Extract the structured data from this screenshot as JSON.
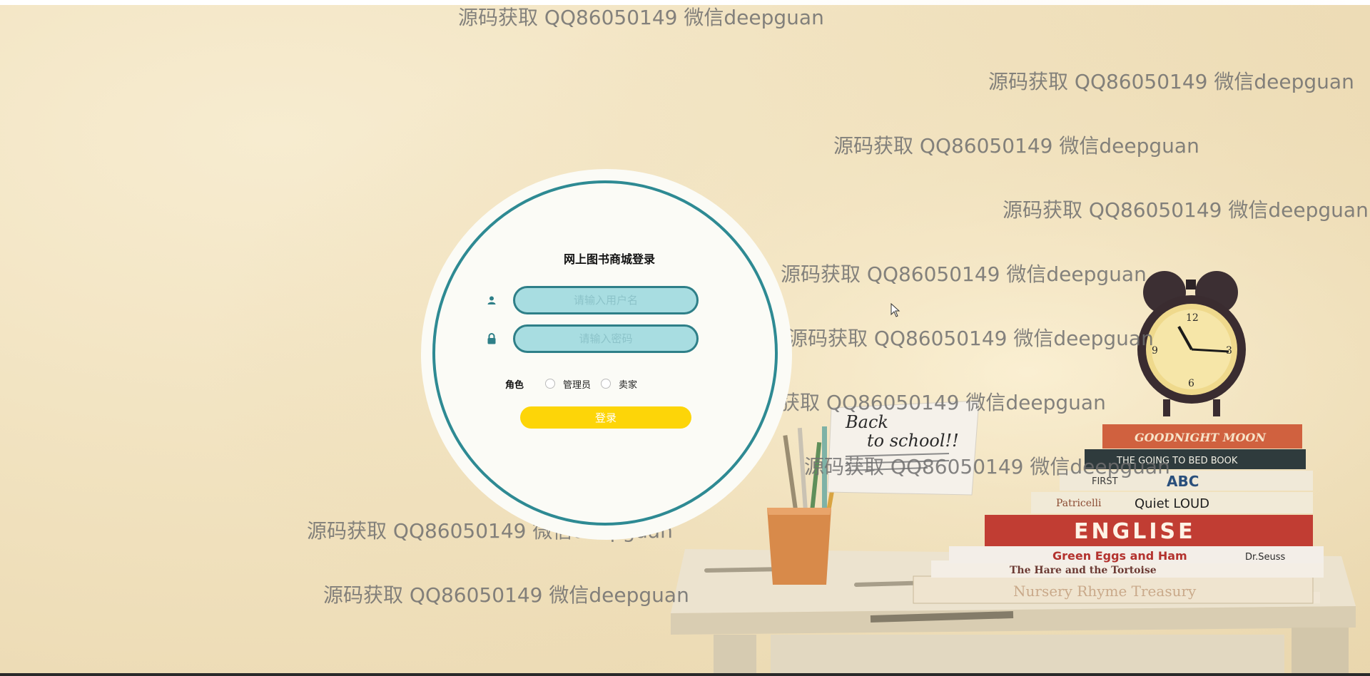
{
  "login": {
    "title": "网上图书商城登录",
    "username_placeholder": "请输入用户名",
    "password_placeholder": "请输入密码",
    "role_label": "角色",
    "role_options": [
      "管理员",
      "卖家"
    ],
    "selected_role": null,
    "submit_label": "登录"
  },
  "watermark_text": "源码获取 QQ86050149 微信deepguan",
  "scene": {
    "note": {
      "line1": "Back",
      "line2": "to school!!"
    },
    "books": [
      "GOODNIGHT MOON",
      "THE GOING TO BED BOOK",
      "FIRST",
      "ABC",
      "Patricelli",
      "Quiet LOUD",
      "ENGLISE",
      "Green Eggs and Ham",
      "Dr.Seuss",
      "The Hare and the Tortoise",
      "Nursery Rhyme Treasury"
    ]
  },
  "colors": {
    "ring": "#2e8a93",
    "input_bg": "#a8dde1",
    "button": "#fdd508",
    "background": "#f1e2bf"
  },
  "icons": [
    "user-icon",
    "lock-icon",
    "cursor-icon",
    "alarm-clock-icon"
  ]
}
